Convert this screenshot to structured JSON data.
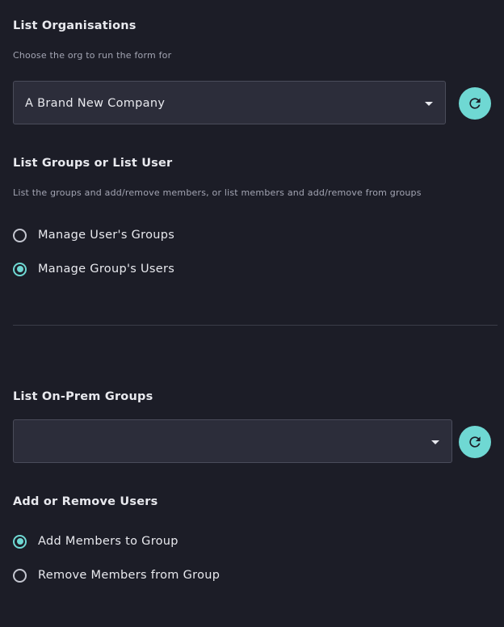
{
  "org_section": {
    "title": "List Organisations",
    "description": "Choose the org to run the form for",
    "selected_value": "A Brand New Company"
  },
  "mode_section": {
    "title": "List Groups or List User",
    "description": "List the groups and add/remove members, or list members and add/remove from groups",
    "options": [
      {
        "label": "Manage User's Groups",
        "checked": false
      },
      {
        "label": "Manage Group's Users",
        "checked": true
      }
    ]
  },
  "onprem_section": {
    "title": "List On-Prem Groups",
    "selected_value": ""
  },
  "action_section": {
    "title": "Add or Remove Users",
    "options": [
      {
        "label": "Add Members to Group",
        "checked": true
      },
      {
        "label": "Remove Members from Group",
        "checked": false
      }
    ]
  },
  "colors": {
    "background": "#1c1d27",
    "accent": "#6fd8d3",
    "field_background": "#2c2d3a"
  },
  "icons": {
    "refresh": "refresh-icon",
    "dropdown": "chevron-down-icon"
  }
}
